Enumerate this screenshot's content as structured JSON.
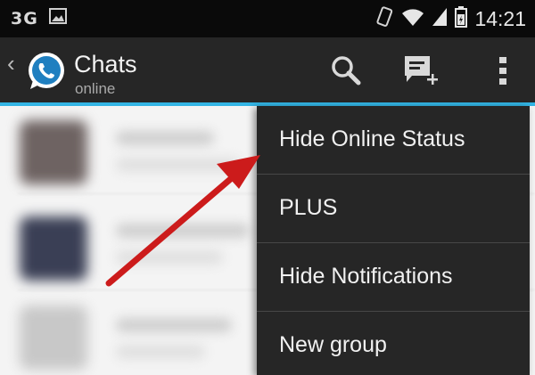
{
  "status_bar": {
    "network": "3G",
    "time": "14:21"
  },
  "action_bar": {
    "title": "Chats",
    "subtitle": "online",
    "icons": [
      "back-chevron-icon",
      "whatsapp-logo-icon",
      "search-icon",
      "new-chat-icon",
      "overflow-menu-icon"
    ],
    "accent_color": "#33b5e5"
  },
  "menu": {
    "items": [
      {
        "label": "Hide Online Status"
      },
      {
        "label": "PLUS"
      },
      {
        "label": "Hide Notifications"
      },
      {
        "label": "New group"
      }
    ]
  },
  "colors": {
    "action_bar_bg": "#262626",
    "menu_bg": "#262626",
    "arrow": "#cc1b1b",
    "logo_green": "#1f7fc0"
  }
}
